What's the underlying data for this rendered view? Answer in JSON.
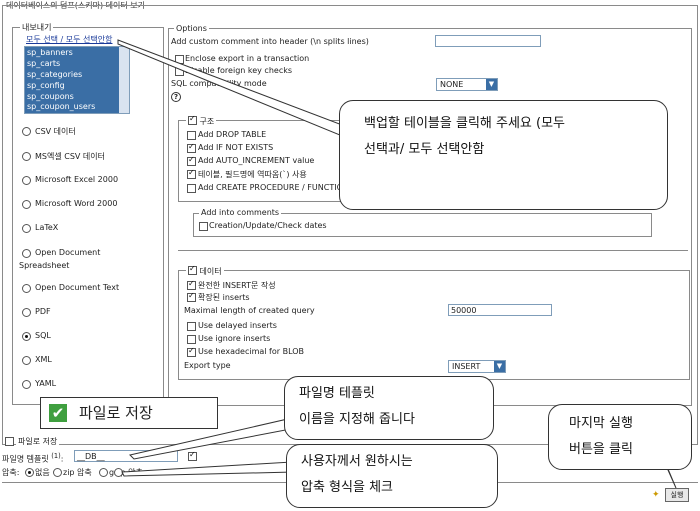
{
  "top_title": "데이터베이스의 덤프(스키마) 데이터 보기",
  "export": {
    "legend": "내보내기",
    "select_links": "모두 선택 / 모두 선택안함",
    "tables": [
      "sp_banners",
      "sp_carts",
      "sp_categories",
      "sp_config",
      "sp_coupons",
      "sp_coupon_users"
    ],
    "formats": [
      "CSV 데이터",
      "MS엑셀 CSV 데이터",
      "Microsoft Excel 2000",
      "Microsoft Word 2000",
      "LaTeX",
      "Open Document",
      "Spreadsheet",
      "Open Document Text",
      "PDF",
      "SQL",
      "XML",
      "YAML"
    ],
    "selected_format": "SQL"
  },
  "options": {
    "legend": "Options",
    "add_comment_label": "Add custom comment into header (\\n splits lines)",
    "enclose_transaction": "Enclose export in a transaction",
    "disable_fk": "Disable foreign key checks",
    "compat_label": "SQL compatibility mode",
    "compat_value": "NONE",
    "structure": {
      "legend": "구조",
      "items": [
        "Add DROP TABLE",
        "Add IF NOT EXISTS",
        "Add AUTO_INCREMENT value",
        "테이블, 필드명에 역따옴(`) 사용",
        "Add CREATE PROCEDURE / FUNCTION"
      ],
      "comments_legend": "Add into comments",
      "comments_item": "Creation/Update/Check dates"
    },
    "data": {
      "legend": "데이터",
      "complete_insert": "완전한 INSERT문 작성",
      "extended_insert": "확장된 inserts",
      "max_length_label": "Maximal length of created query",
      "max_length_value": "50000",
      "delayed": "Use delayed inserts",
      "ignore": "Use ignore inserts",
      "hex_blob": "Use hexadecimal for BLOB",
      "export_type_label": "Export type",
      "export_type_value": "INSERT"
    }
  },
  "save": {
    "legend": "파일로 저장",
    "template_label": "파일명 템플릿",
    "template_sup": "(1)",
    "template_value": "__DB__",
    "compression_label": "압축:",
    "compression_options": [
      "없음",
      "zip 압축",
      "gzip 압축"
    ],
    "go_button": "실행"
  },
  "callouts": {
    "select_tables": [
      "백업할 테이블을 클릭해 주세요 (모두",
      "선택과/ 모두 선택안함"
    ],
    "save_file": "파일로 저장",
    "filename": [
      "파일명 테플릿",
      "이름을 지정해 줍니다"
    ],
    "compression": [
      "사용자께서 원하시는",
      "압축 형식을 체크"
    ],
    "run": [
      "마지막 실행",
      "버튼을 클릭"
    ]
  },
  "colors": {
    "selected_bg": "#3a6ea5",
    "accent_green": "#3f9f3f"
  }
}
